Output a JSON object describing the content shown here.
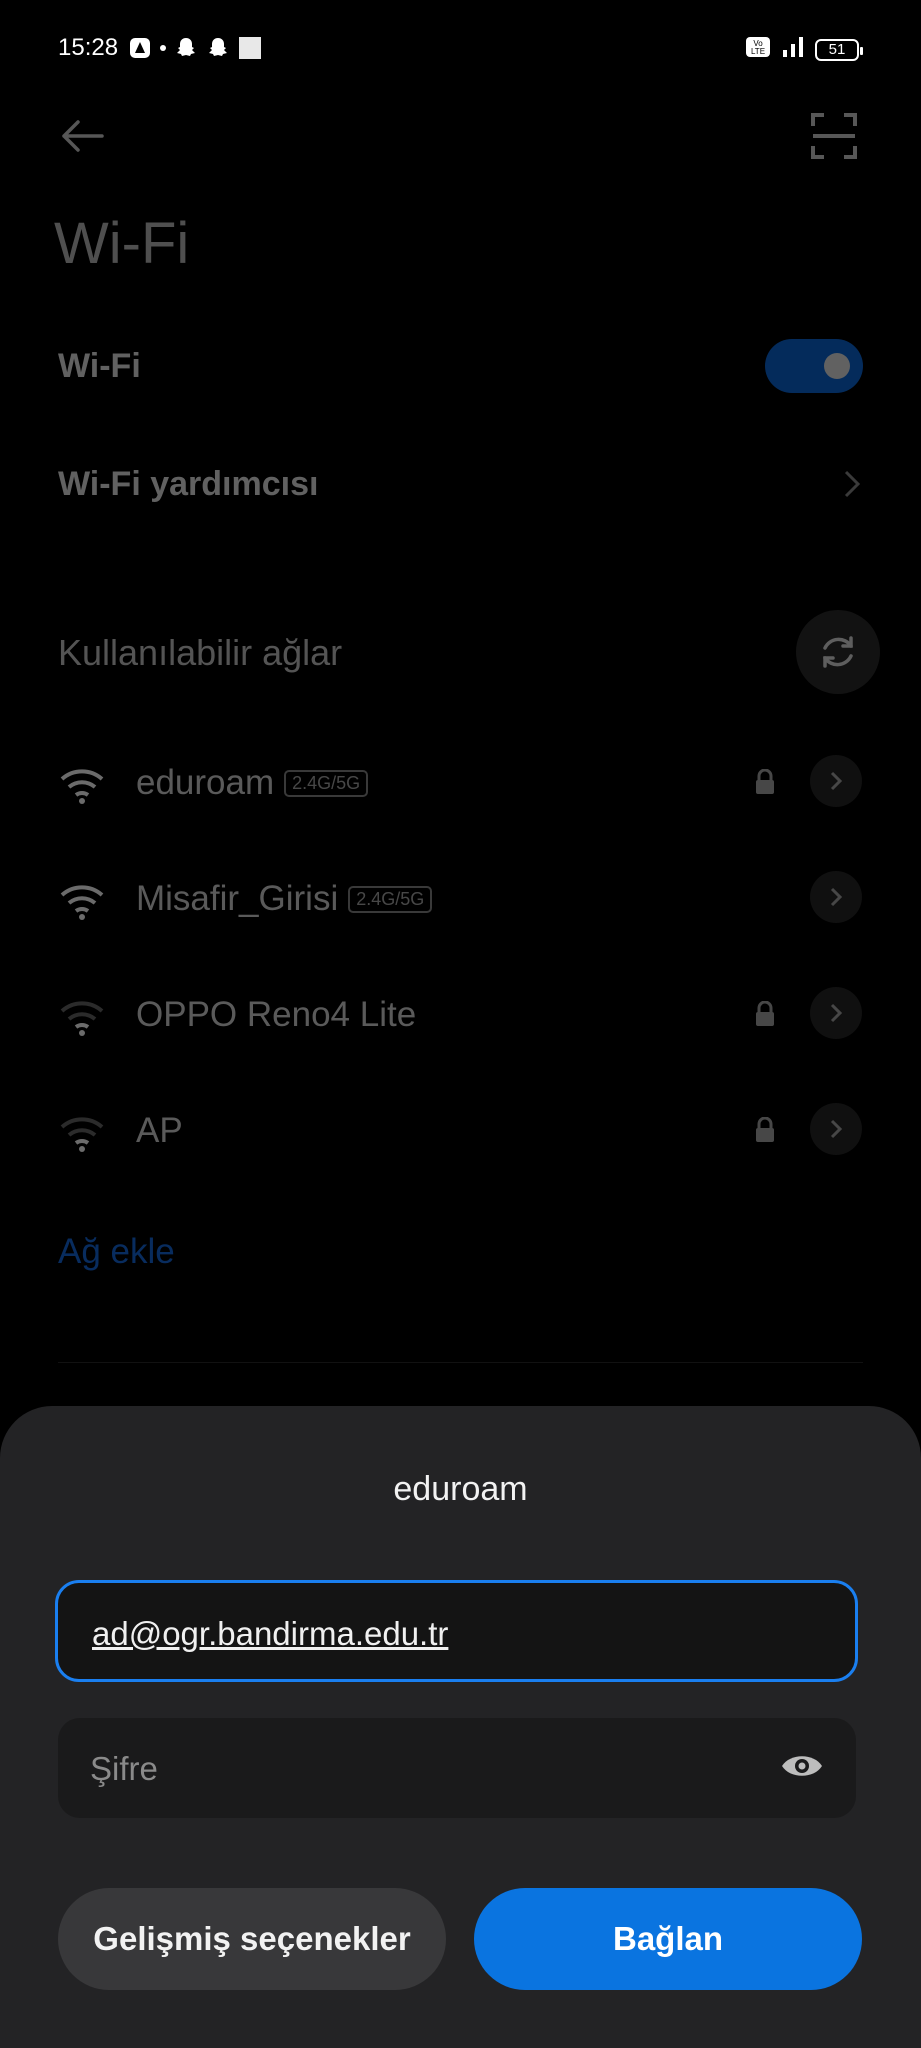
{
  "status_bar": {
    "time": "15:28",
    "battery": "51",
    "volte": "Vo LTE"
  },
  "header": {
    "title": "Wi-Fi"
  },
  "settings": {
    "wifi_label": "Wi-Fi",
    "wifi_enabled": true,
    "assistant_label": "Wi-Fi yardımcısı"
  },
  "networks": {
    "section_title": "Kullanılabilir ağlar",
    "items": [
      {
        "name": "eduroam",
        "band": "2.4G/5G",
        "locked": true
      },
      {
        "name": "Misafir_Girisi",
        "band": "2.4G/5G",
        "locked": false
      },
      {
        "name": "OPPO Reno4 Lite",
        "band": "",
        "locked": true
      },
      {
        "name": "AP",
        "band": "",
        "locked": true
      }
    ],
    "add_label": "Ağ ekle"
  },
  "dialog": {
    "title": "eduroam",
    "identity_value": "ad@ogr.bandirma.edu.tr",
    "password_placeholder": "Şifre",
    "advanced_label": "Gelişmiş seçenekler",
    "connect_label": "Bağlan"
  },
  "colors": {
    "accent": "#0a74e0",
    "sheet_bg": "#232325",
    "background": "#000000"
  }
}
